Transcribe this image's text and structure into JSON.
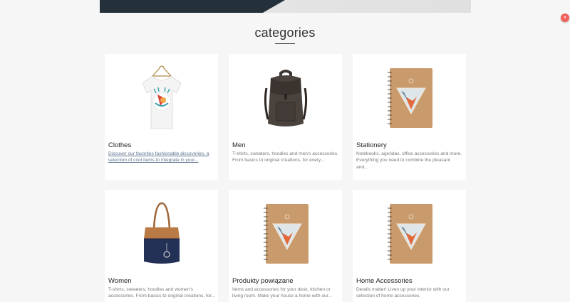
{
  "section": {
    "title": "categories"
  },
  "close_fab": {
    "glyph": "×"
  },
  "categories": [
    {
      "title": "Clothes",
      "description": "Discover our favorites fashionable discoveries, a selection of cool items to integrate in your...",
      "icon": "tshirt-icon"
    },
    {
      "title": "Men",
      "description": "T-shirts, sweaters, hoodies and men's accessories. From basics to original creations, for every...",
      "icon": "backpack-icon"
    },
    {
      "title": "Stationery",
      "description": "Notebooks, agendas, office accessories and more. Everything you need to combine the pleasant and...",
      "icon": "notebook-icon"
    },
    {
      "title": "Women",
      "description": "T-shirts, sweaters, hoodies and women's accessories. From basics to original creations, for...",
      "icon": "tote-bag-icon"
    },
    {
      "title": "Produkty powiązane",
      "description": "Items and accessories for your desk, kitchen or living room. Make your house a home with our...",
      "icon": "notebook-icon"
    },
    {
      "title": "Home Accessories",
      "description": "Details matter! Liven up your interior with our selection of home accessories.",
      "icon": "notebook-icon"
    }
  ],
  "colors": {
    "accent": "#f0605a",
    "hero_dark": "#24303a",
    "link": "#5d7390"
  }
}
